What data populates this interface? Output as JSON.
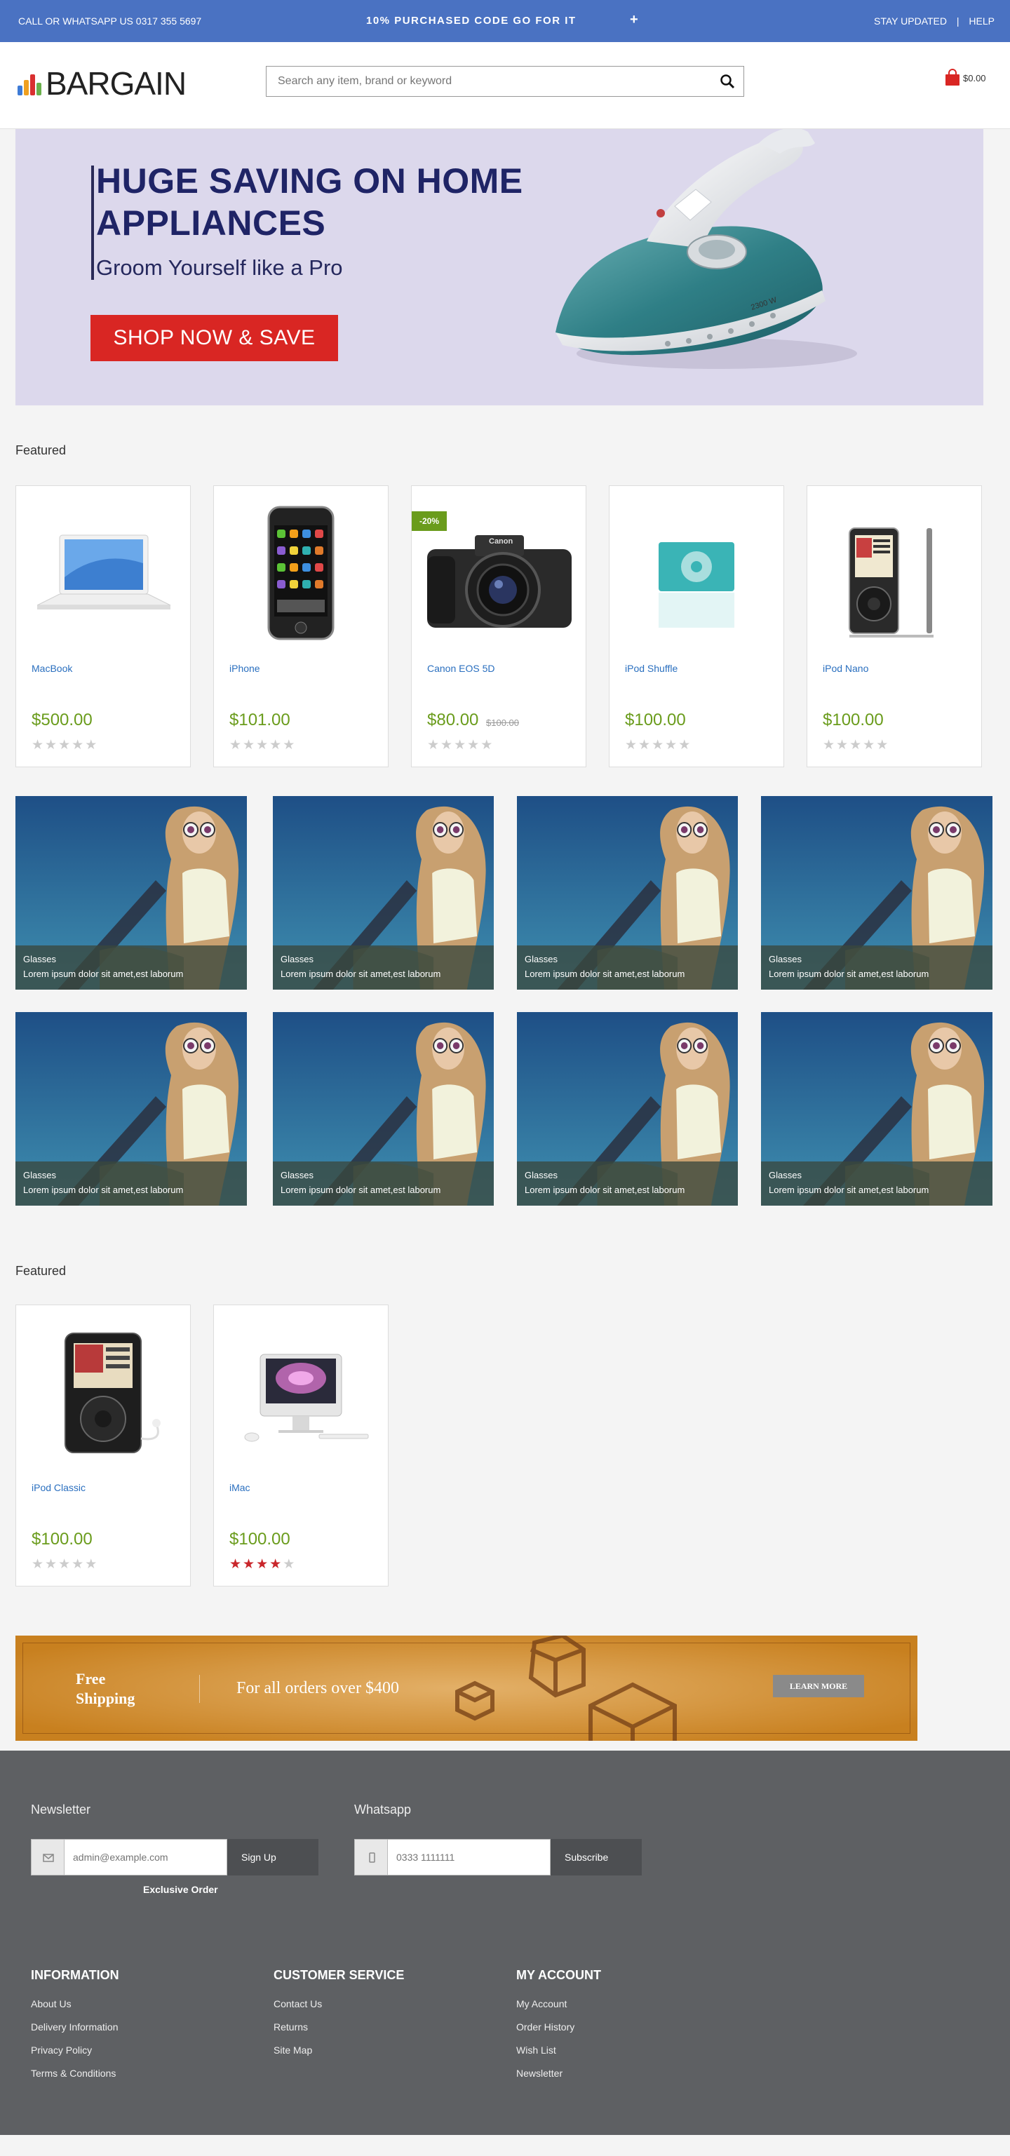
{
  "topbar": {
    "contact": "CALL OR WHATSAPP US 0317 355 5697",
    "promo": "10% PURCHASED CODE GO FOR IT",
    "stay_updated": "STAY UPDATED",
    "divider": "|",
    "help": "HELP"
  },
  "header": {
    "logo_text": "BARGAIN",
    "search_placeholder": "Search any item, brand or keyword",
    "cart_amount": "$0.00"
  },
  "hero": {
    "title": "HUGE SAVING ON HOME APPLIANCES",
    "subtitle": "Groom Yourself like a Pro",
    "cta": "SHOP NOW & SAVE",
    "iron_label": "2300 W"
  },
  "featured1": {
    "title": "Featured",
    "products": [
      {
        "name": "MacBook",
        "price": "$500.00",
        "old_price": "",
        "badge": "",
        "rating": 0,
        "image": "macbook"
      },
      {
        "name": "iPhone",
        "price": "$101.00",
        "old_price": "",
        "badge": "",
        "rating": 0,
        "image": "iphone"
      },
      {
        "name": "Canon EOS 5D",
        "price": "$80.00",
        "old_price": "$100.00",
        "badge": "-20%",
        "rating": 0,
        "image": "camera"
      },
      {
        "name": "iPod Shuffle",
        "price": "$100.00",
        "old_price": "",
        "badge": "",
        "rating": 0,
        "image": "shuffle"
      },
      {
        "name": "iPod Nano",
        "price": "$100.00",
        "old_price": "",
        "badge": "",
        "rating": 0,
        "image": "nano"
      }
    ]
  },
  "banners": [
    {
      "title": "Glasses",
      "text": "Lorem ipsum dolor sit amet,est laborum"
    },
    {
      "title": "Glasses",
      "text": "Lorem ipsum dolor sit amet,est laborum"
    },
    {
      "title": "Glasses",
      "text": "Lorem ipsum dolor sit amet,est laborum"
    },
    {
      "title": "Glasses",
      "text": "Lorem ipsum dolor sit amet,est laborum"
    },
    {
      "title": "Glasses",
      "text": "Lorem ipsum dolor sit amet,est laborum"
    },
    {
      "title": "Glasses",
      "text": "Lorem ipsum dolor sit amet,est laborum"
    },
    {
      "title": "Glasses",
      "text": "Lorem ipsum dolor sit amet,est laborum"
    },
    {
      "title": "Glasses",
      "text": "Lorem ipsum dolor sit amet,est laborum"
    }
  ],
  "featured2": {
    "title": "Featured",
    "products": [
      {
        "name": "iPod Classic",
        "price": "$100.00",
        "old_price": "",
        "badge": "",
        "rating": 0,
        "image": "classic"
      },
      {
        "name": "iMac",
        "price": "$100.00",
        "old_price": "",
        "badge": "",
        "rating": 4,
        "image": "imac"
      }
    ]
  },
  "shipping": {
    "title_line1": "Free",
    "title_line2": "Shipping",
    "text": "For all orders over $400",
    "button": "LEARN MORE"
  },
  "footer": {
    "newsletter": {
      "label": "Newsletter",
      "placeholder": "admin@example.com",
      "button": "Sign Up",
      "note": "Exclusive Order"
    },
    "whatsapp": {
      "label": "Whatsapp",
      "placeholder": "0333 1111111",
      "button": "Subscribe"
    },
    "columns": [
      {
        "title": "INFORMATION",
        "links": [
          "About Us",
          "Delivery Information",
          "Privacy Policy",
          "Terms & Conditions"
        ]
      },
      {
        "title": "CUSTOMER SERVICE",
        "links": [
          "Contact Us",
          "Returns",
          "Site Map"
        ]
      },
      {
        "title": "MY ACCOUNT",
        "links": [
          "My Account",
          "Order History",
          "Wish List",
          "Newsletter"
        ]
      }
    ]
  },
  "colors": {
    "topbar": "#4a72c2",
    "cta_red": "#d92623",
    "price_green": "#6a9c1c",
    "link_blue": "#2a6fbf",
    "footer_bg": "#5e6063"
  }
}
